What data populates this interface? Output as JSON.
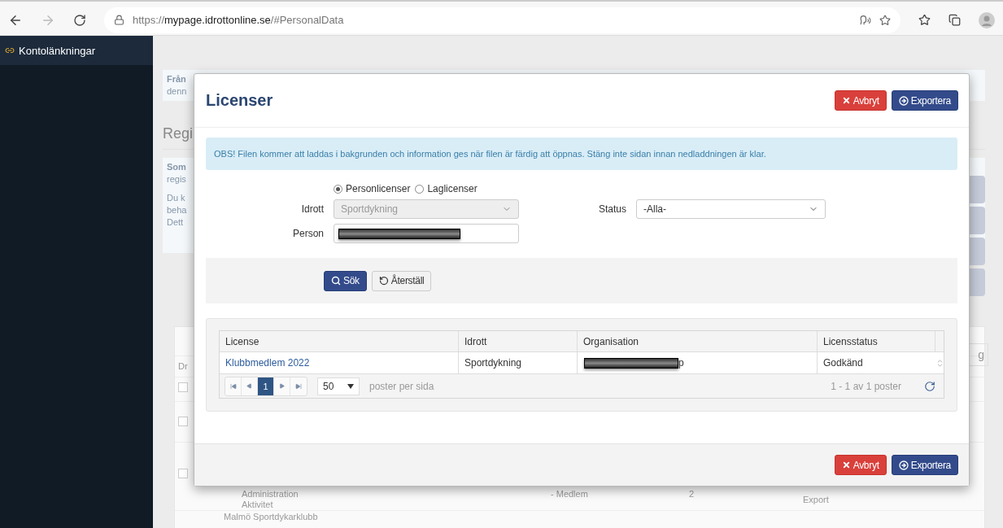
{
  "browser": {
    "url_scheme": "https://",
    "url_domain": "mypage.idrottonline.se",
    "url_path": "/#PersonalData"
  },
  "sidebar": {
    "items": [
      {
        "label": "Kontolänkningar",
        "selected": false
      }
    ]
  },
  "background": {
    "panel_1_lines": [
      "Från",
      "denn"
    ],
    "heading": "Regi",
    "panel_2_lines": [
      "Som",
      "regis"
    ],
    "panel_2_paragraph": [
      "Du k",
      "beha",
      "Dett"
    ],
    "table_fragment": "Dr",
    "button_fragment": "g",
    "checkboxes": [
      {
        "checked": false
      },
      {
        "checked": false
      },
      {
        "checked": false
      }
    ],
    "row_texts": [
      "Administration",
      "Aktivitet"
    ],
    "row_role": "- Medlem",
    "row_count": "2",
    "row_action": "Export",
    "group_row": "Malmö Sportdykarklubb"
  },
  "modal": {
    "title": "Licenser",
    "header_buttons": [
      {
        "kind": "cancel",
        "label": "Avbryt"
      },
      {
        "kind": "export",
        "label": "Exportera"
      }
    ],
    "alert": "OBS! Filen kommer att laddas i bakgrunden och information ges när filen är färdig att öppnas. Stäng inte sidan innan nedladdningen är klar.",
    "license_types": [
      {
        "label": "Personlicenser",
        "selected": true
      },
      {
        "label": "Laglicenser",
        "selected": false
      }
    ],
    "sport": {
      "label": "Idrott",
      "value": "Sportdykning",
      "disabled": true
    },
    "status": {
      "label": "Status",
      "value": "-Alla-",
      "disabled": false
    },
    "person": {
      "label": "Person",
      "redacted": true
    },
    "search_buttons": [
      {
        "kind": "search",
        "label": "Sök"
      },
      {
        "kind": "reset",
        "label": "Återställ"
      }
    ],
    "table": {
      "columns": [
        "License",
        "Idrott",
        "Organisation",
        "Licensstatus"
      ],
      "rows": [
        {
          "license": "Klubbmedlem 2022",
          "sport": "Sportdykning",
          "organisation": "p",
          "organisation_redacted": true,
          "status": "Godkänd"
        }
      ]
    },
    "pager": {
      "pages": [
        {
          "label": "1",
          "selected": true
        }
      ],
      "page_size": "50",
      "page_size_label": "poster per sida",
      "summary": "1 - 1 av 1 poster"
    },
    "footer_buttons": [
      {
        "kind": "cancel",
        "label": "Avbryt"
      },
      {
        "kind": "export",
        "label": "Exportera"
      }
    ]
  }
}
